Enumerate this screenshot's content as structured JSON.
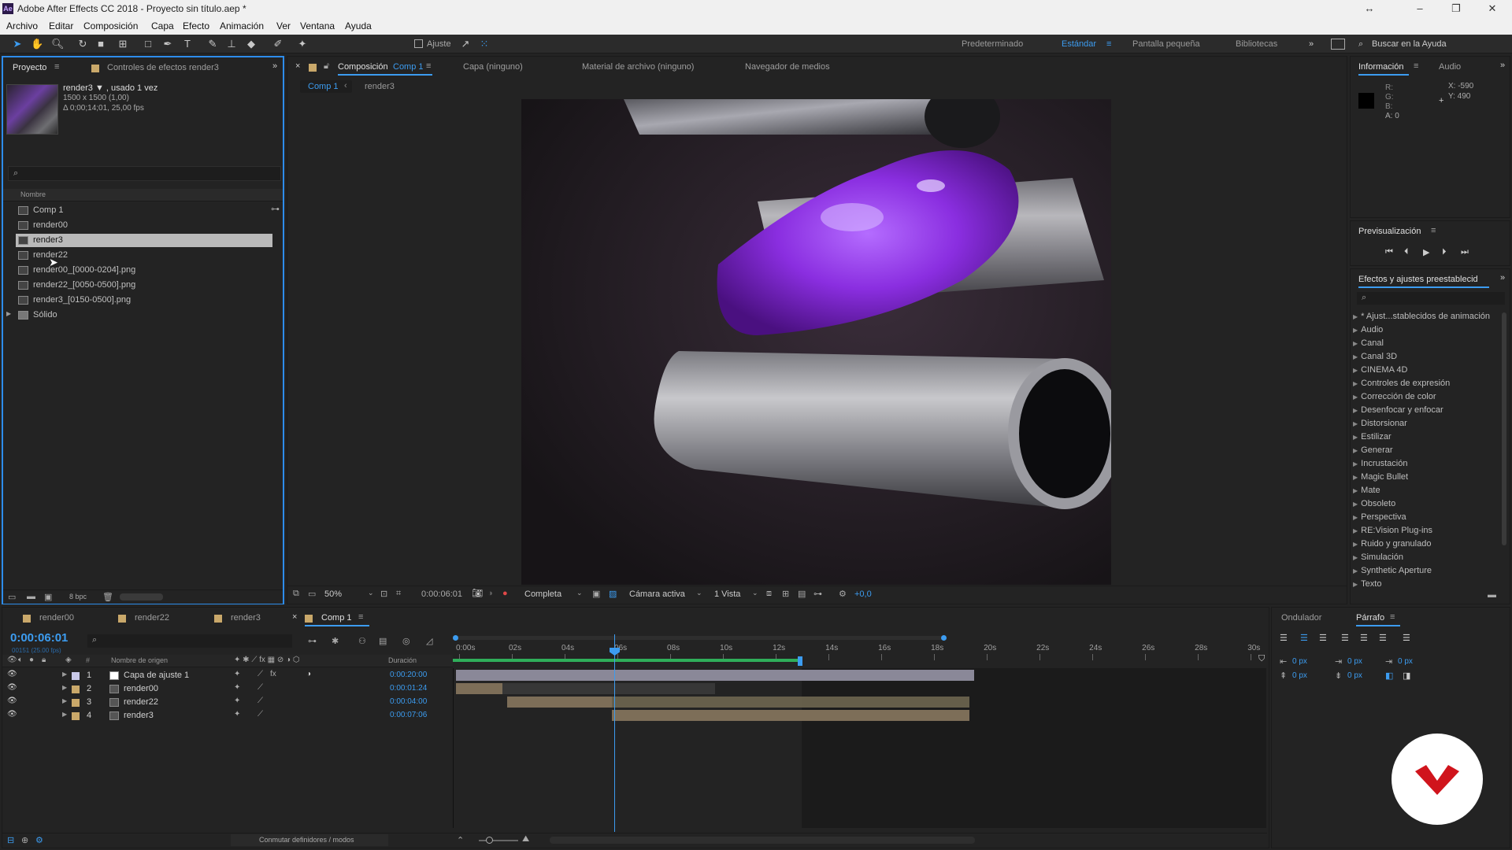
{
  "titlebar": {
    "title": "Adobe After Effects CC 2018 - Proyecto sin título.aep *",
    "app_icon": "Ae"
  },
  "menu": [
    "Archivo",
    "Editar",
    "Composición",
    "Capa",
    "Efecto",
    "Animación",
    "Ver",
    "Ventana",
    "Ayuda"
  ],
  "toolbar": {
    "snap_label": "Ajuste",
    "workspaces": [
      "Predeterminado",
      "Estándar",
      "Pantalla pequeña",
      "Bibliotecas"
    ],
    "search_placeholder": "Buscar en la Ayuda"
  },
  "project": {
    "tabs": [
      "Proyecto",
      "Controles de efectos render3"
    ],
    "selected_name": "render3 ▼ , usado 1 vez",
    "selected_dims": "1500 x 1500 (1,00)",
    "selected_dur": "Δ 0;00;14;01, 25,00 fps",
    "col_name": "Nombre",
    "items": [
      "Comp 1",
      "render00",
      "render3",
      "render22",
      "render00_[0000-0204].png",
      "render22_[0050-0500].png",
      "render3_[0150-0500].png",
      "Sólido"
    ],
    "bpc": "8 bpc"
  },
  "comp": {
    "tabs": [
      "Composición",
      "Capa (ninguno)",
      "Material de archivo (ninguno)",
      "Navegador de medios"
    ],
    "comp_tab_name": "Comp 1",
    "breadcrumbs": [
      "Comp 1",
      "render3"
    ],
    "zoom": "50%",
    "timecode": "0:00:06:01",
    "resolution": "Completa",
    "camera": "Cámara activa",
    "views": "1 Vista",
    "exposure": "+0,0"
  },
  "info": {
    "tabs": [
      "Información",
      "Audio"
    ],
    "r": "R:",
    "g": "G:",
    "b": "B:",
    "a": "A:  0",
    "x": "X:  -590",
    "y": "Y:  490"
  },
  "preview": {
    "title": "Previsualización"
  },
  "effects": {
    "title": "Efectos y ajustes preestablecidos",
    "title_shown": "Efectos y ajustes preestablecid",
    "items": [
      "* Ajust...stablecidos de animación",
      "Audio",
      "Canal",
      "Canal 3D",
      "CINEMA 4D",
      "Controles de expresión",
      "Corrección de color",
      "Desenfocar y enfocar",
      "Distorsionar",
      "Estilizar",
      "Generar",
      "Incrustación",
      "Magic Bullet",
      "Mate",
      "Obsoleto",
      "Perspectiva",
      "RE:Vision Plug-ins",
      "Ruido y granulado",
      "Simulación",
      "Synthetic Aperture",
      "Texto"
    ]
  },
  "timeline": {
    "tabs": [
      "render00",
      "render22",
      "render3",
      "Comp 1"
    ],
    "timecode": "0:00:06:01",
    "subtime": "00151 (25.00 fps)",
    "col_source": "Nombre de origen",
    "col_duration": "Duración",
    "ruler": [
      "0:00s",
      "02s",
      "04s",
      "06s",
      "08s",
      "10s",
      "12s",
      "14s",
      "16s",
      "18s",
      "20s",
      "22s",
      "24s",
      "26s",
      "28s",
      "30s"
    ],
    "layers": [
      {
        "num": "1",
        "name": "Capa de ajuste 1",
        "duration": "0:00:20:00"
      },
      {
        "num": "2",
        "name": "render00",
        "duration": "0:00:01:24"
      },
      {
        "num": "3",
        "name": "render22",
        "duration": "0:00:04:00"
      },
      {
        "num": "4",
        "name": "render3",
        "duration": "0:00:07:06"
      }
    ],
    "footer": "Conmutar definidores / modos"
  },
  "paragraph": {
    "tabs": [
      "Ondulador",
      "Párrafo"
    ],
    "px": [
      "0 px",
      "0 px",
      "0 px",
      "0 px",
      "0 px"
    ]
  }
}
